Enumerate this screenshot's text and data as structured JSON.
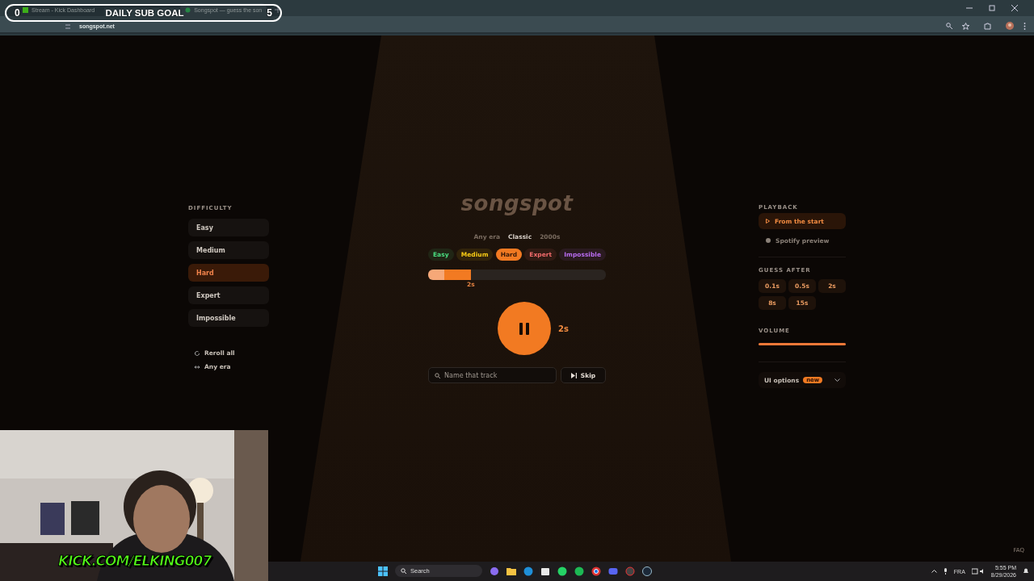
{
  "browser": {
    "tabs": [
      {
        "title": "Stream - Kick Dashboard",
        "selected": false
      },
      {
        "title": "Songspot — guess the son",
        "selected": true
      }
    ],
    "url": "songspot.net"
  },
  "sub_goal": {
    "start": "0",
    "title": "DAILY SUB GOAL",
    "end": "5"
  },
  "difficulty_panel": {
    "heading": "DIFFICULTY",
    "items": [
      {
        "label": "Easy",
        "selected": false
      },
      {
        "label": "Medium",
        "selected": false
      },
      {
        "label": "Hard",
        "selected": true
      },
      {
        "label": "Expert",
        "selected": false
      },
      {
        "label": "Impossible",
        "selected": false
      }
    ],
    "actions": [
      {
        "label": "Reroll all",
        "kind": "reroll"
      },
      {
        "label": "Any era",
        "kind": "era"
      }
    ]
  },
  "game": {
    "logo": "songspot",
    "eras": [
      {
        "label": "Any era",
        "selected": false
      },
      {
        "label": "Classic",
        "selected": true
      },
      {
        "label": "2000s",
        "selected": false
      }
    ],
    "chips": [
      {
        "label": "Easy",
        "color": "#4ade80",
        "selected": false
      },
      {
        "label": "Medium",
        "color": "#facc15",
        "selected": false
      },
      {
        "label": "Hard",
        "color": "#f27a22",
        "selected": true
      },
      {
        "label": "Expert",
        "color": "#f26b6b",
        "selected": false
      },
      {
        "label": "Impossible",
        "color": "#b86cf0",
        "selected": false
      }
    ],
    "progress": {
      "level": 0.24,
      "marker": "2s"
    },
    "playing": true,
    "elapsed": "2s",
    "search": {
      "placeholder": "Name that track"
    },
    "skip": "Skip"
  },
  "settings_panel": {
    "playback_heading": "PLAYBACK",
    "playback": [
      {
        "label": "From the start",
        "kind": "play",
        "selected": true
      },
      {
        "label": "Spotify preview",
        "kind": "spotify",
        "selected": false
      }
    ],
    "guess_heading": "GUESS AFTER",
    "guess_after": [
      "0.1s",
      "0.5s",
      "2s",
      "8s",
      "15s"
    ],
    "volume_heading": "VOLUME",
    "volume": {
      "level": 1.0
    },
    "ui_options": "UI options",
    "badge": "new"
  },
  "faq": "FAQ",
  "webcam": {
    "kind": "picture",
    "caption": "KICK.COM/ELKING007"
  },
  "taskbar": {
    "search": "Search",
    "language": "FRA",
    "time": "5:55 PM",
    "date": "8/29/2026"
  }
}
